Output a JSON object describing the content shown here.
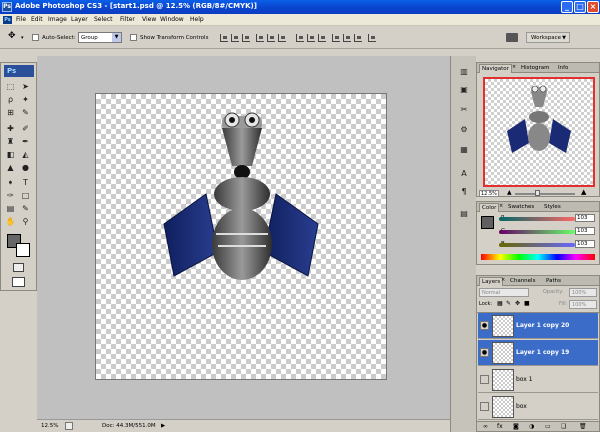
{
  "window": {
    "title": "Adobe Photoshop CS3 - [start1.psd @ 12.5% (RGB/8#/CMYK)]"
  },
  "menu": [
    "File",
    "Edit",
    "Image",
    "Layer",
    "Select",
    "Filter",
    "View",
    "Window",
    "Help"
  ],
  "options": {
    "auto_select_label": "Auto-Select:",
    "auto_select_value": "Group",
    "show_transform_label": "Show Transform Controls",
    "workspace_label": "Workspace"
  },
  "tools": {
    "logo": "Ps"
  },
  "navigator": {
    "tabs": [
      "Navigator",
      "Histogram",
      "Info"
    ],
    "zoom": "12.5%"
  },
  "color": {
    "tabs": [
      "Color",
      "Swatches",
      "Styles"
    ],
    "channels": [
      {
        "label": "R",
        "value": "103"
      },
      {
        "label": "G",
        "value": "103"
      },
      {
        "label": "B",
        "value": "103"
      }
    ],
    "accent": "#606060"
  },
  "layers": {
    "tabs": [
      "Layers",
      "Channels",
      "Paths"
    ],
    "blend_mode": "Normal",
    "opacity_label": "Opacity:",
    "opacity_value": "100%",
    "fill_label": "Fill:",
    "fill_value": "100%",
    "lock_label": "Lock:",
    "items": [
      {
        "name": "Layer 1 copy 20",
        "selected": true,
        "visible": true
      },
      {
        "name": "Layer 1 copy 19",
        "selected": true,
        "visible": true
      },
      {
        "name": "box 1",
        "selected": false,
        "visible": false
      },
      {
        "name": "box",
        "selected": false,
        "visible": false
      }
    ]
  },
  "status": {
    "zoom": "12.5%",
    "doc": "Doc: 44.3M/551.0M"
  }
}
